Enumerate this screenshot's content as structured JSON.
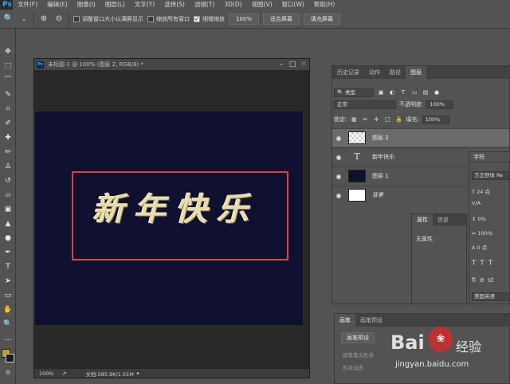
{
  "app": {
    "logo": "Ps",
    "menu": [
      "文件(F)",
      "编辑(E)",
      "图像(I)",
      "图层(L)",
      "文字(Y)",
      "选择(S)",
      "滤镜(T)",
      "3D(D)",
      "视图(V)",
      "窗口(W)",
      "帮助(H)"
    ]
  },
  "options": {
    "tool_icon": "zoom-icon",
    "chk_resize": "调整窗口大小以满屏显示",
    "chk_zoom_all": "缩放所有窗口",
    "chk_scrubby": "细微缩放",
    "scrubby_checked": true,
    "btn_100": "100%",
    "btn_fit": "适合屏幕",
    "btn_fill": "填充屏幕"
  },
  "tools": [
    "move-icon",
    "marquee-icon",
    "lasso-icon",
    "quick-select-icon",
    "crop-icon",
    "eyedropper-icon",
    "healing-icon",
    "brush-icon",
    "stamp-icon",
    "history-brush-icon",
    "eraser-icon",
    "gradient-icon",
    "blur-icon",
    "dodge-icon",
    "pen-icon",
    "type-icon",
    "path-select-icon",
    "shape-icon",
    "hand-icon",
    "zoom-icon",
    "more-icon"
  ],
  "colors": {
    "foreground": "#b8a22d",
    "background": "#1a1a1a",
    "canvas": "#101030",
    "selection": "#e04040"
  },
  "document": {
    "title": "未标题-1 @ 100% (图层 2, RGB/8) *",
    "artwork_text": "新年快乐",
    "zoom": "100%",
    "doc_size": "文档:585.9K/1.01M"
  },
  "layers_panel": {
    "tabs": [
      "历史记录",
      "动作",
      "路径",
      "图层"
    ],
    "active_tab": "图层",
    "filter_kind": "类型",
    "blend_mode": "正常",
    "opacity_label": "不透明度:",
    "opacity_value": "100%",
    "lock_label": "锁定:",
    "fill_label": "填充:",
    "fill_value": "100%",
    "layers": [
      {
        "name": "图层 2",
        "thumb": "check",
        "selected": true
      },
      {
        "name": "新年快乐",
        "thumb": "type",
        "selected": false
      },
      {
        "name": "图层 1",
        "thumb": "navy",
        "selected": false
      },
      {
        "name": "背景",
        "thumb": "white",
        "selected": false
      }
    ]
  },
  "char_panel": {
    "tab": "字符",
    "font": "方正舒体 Re",
    "size": "24 点",
    "tracking_label": "V/A",
    "scale_v": "0%",
    "scale_h": "100%",
    "baseline": "0 点",
    "lang": "美国英语"
  },
  "props_panel": {
    "tabs": [
      "属性",
      "信息"
    ],
    "body": "无属性"
  },
  "brush_panel": {
    "tabs": [
      "画笔",
      "画笔预设"
    ],
    "preset_button": "画笔预设",
    "lines": [
      "画笔笔尖形状",
      "形状动态"
    ]
  },
  "watermark": {
    "logo": "Bai",
    "cn": "经验",
    "url": "jingyan.baidu.com"
  }
}
